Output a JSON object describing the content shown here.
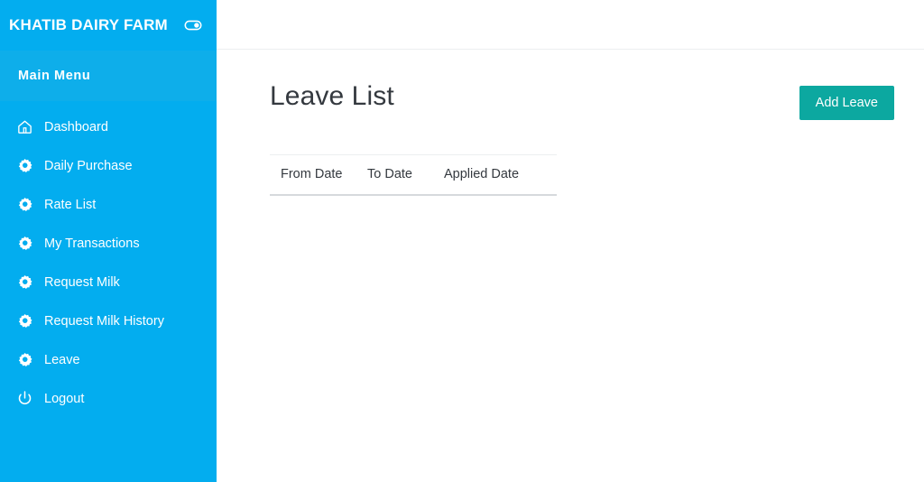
{
  "brand": {
    "title": "KHATIB DAIRY FARM",
    "toggle_icon": "sidebar-toggle-icon"
  },
  "sidebar": {
    "heading": "Main Menu",
    "bg_color": "#03adef",
    "heading_band_color": "#0eaeea",
    "items": [
      {
        "label": "Dashboard",
        "icon": "home-icon"
      },
      {
        "label": "Daily Purchase",
        "icon": "gear-icon"
      },
      {
        "label": "Rate List",
        "icon": "gear-icon"
      },
      {
        "label": "My Transactions",
        "icon": "gear-icon"
      },
      {
        "label": "Request Milk",
        "icon": "gear-icon"
      },
      {
        "label": "Request Milk History",
        "icon": "gear-icon"
      },
      {
        "label": "Leave",
        "icon": "gear-icon"
      },
      {
        "label": "Logout",
        "icon": "power-icon"
      }
    ]
  },
  "main": {
    "page_title": "Leave List",
    "add_button_label": "Add Leave",
    "add_button_color": "#0ca8a0",
    "table": {
      "columns": [
        "From Date",
        "To Date",
        "Applied Date"
      ],
      "rows": []
    }
  }
}
